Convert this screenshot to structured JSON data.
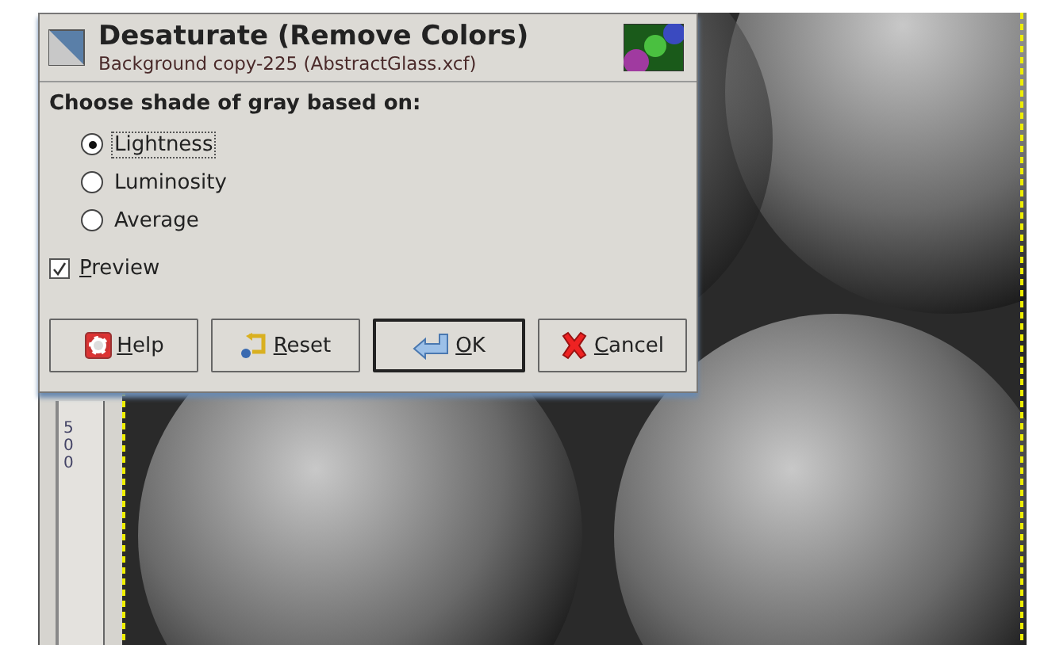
{
  "dialog": {
    "title": "Desaturate (Remove Colors)",
    "subtitle": "Background copy-225 (AbstractGlass.xcf)",
    "prompt": "Choose shade of gray based on:",
    "options": [
      {
        "label": "Lightness",
        "selected": true
      },
      {
        "label": "Luminosity",
        "selected": false
      },
      {
        "label": "Average",
        "selected": false
      }
    ],
    "preview": {
      "label": "Preview",
      "checked": true
    },
    "buttons": [
      {
        "kind": "help",
        "label": "Help",
        "default": false
      },
      {
        "kind": "reset",
        "label": "Reset",
        "default": false
      },
      {
        "kind": "ok",
        "label": "OK",
        "default": true
      },
      {
        "kind": "cancel",
        "label": "Cancel",
        "default": false
      }
    ]
  },
  "ruler": {
    "label": "500"
  }
}
